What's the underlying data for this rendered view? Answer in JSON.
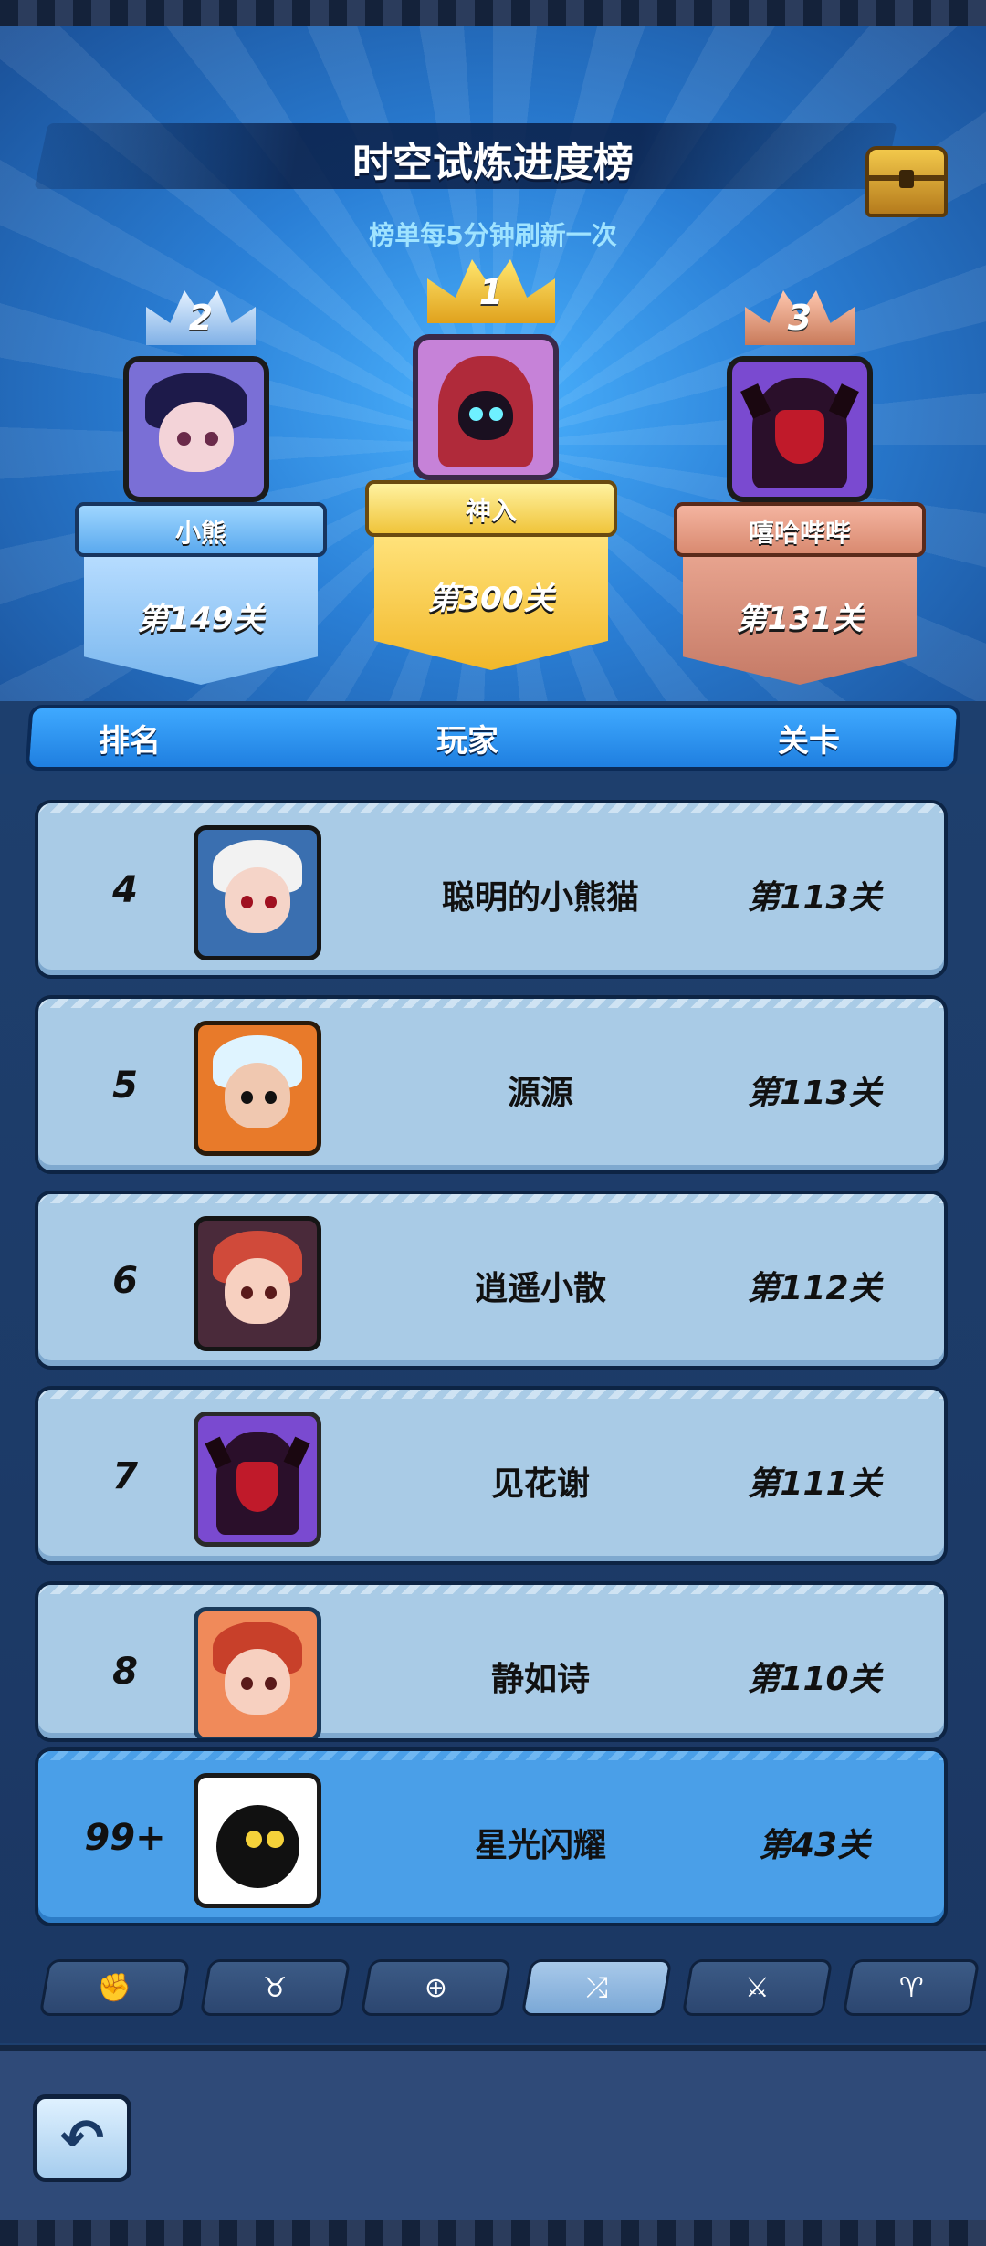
{
  "header": {
    "title": "时空试炼进度榜",
    "subtitle": "榜单每5分钟刷新一次"
  },
  "podium": [
    {
      "rank": "2",
      "name": "小熊",
      "level": "第149关"
    },
    {
      "rank": "1",
      "name": "神入",
      "level": "第300关"
    },
    {
      "rank": "3",
      "name": "嘻哈哔哔",
      "level": "第131关"
    }
  ],
  "table": {
    "col_rank": "排名",
    "col_player": "玩家",
    "col_level": "关卡"
  },
  "rows": [
    {
      "rank": "4",
      "name": "聪明的小熊猫",
      "level": "第113关"
    },
    {
      "rank": "5",
      "name": "源源",
      "level": "第113关"
    },
    {
      "rank": "6",
      "name": "逍遥小散",
      "level": "第112关"
    },
    {
      "rank": "7",
      "name": "见花谢",
      "level": "第111关"
    },
    {
      "rank": "8",
      "name": "静如诗",
      "level": "第110关"
    }
  ],
  "me": {
    "rank": "99+",
    "name": "星光闪耀",
    "level": "第43关"
  },
  "tabs": [
    {
      "icon": "glove-icon",
      "glyph": "✊"
    },
    {
      "icon": "horned-helmet-icon",
      "glyph": "♉"
    },
    {
      "icon": "compass-icon",
      "glyph": "⊕"
    },
    {
      "icon": "scatter-arrows-icon",
      "glyph": "⤮"
    },
    {
      "icon": "sword-icon",
      "glyph": "⚔"
    },
    {
      "icon": "viking-helmet-icon",
      "glyph": "♈"
    }
  ],
  "active_tab": 3,
  "back_icon": "back-arrow-icon",
  "back_glyph": "↶"
}
